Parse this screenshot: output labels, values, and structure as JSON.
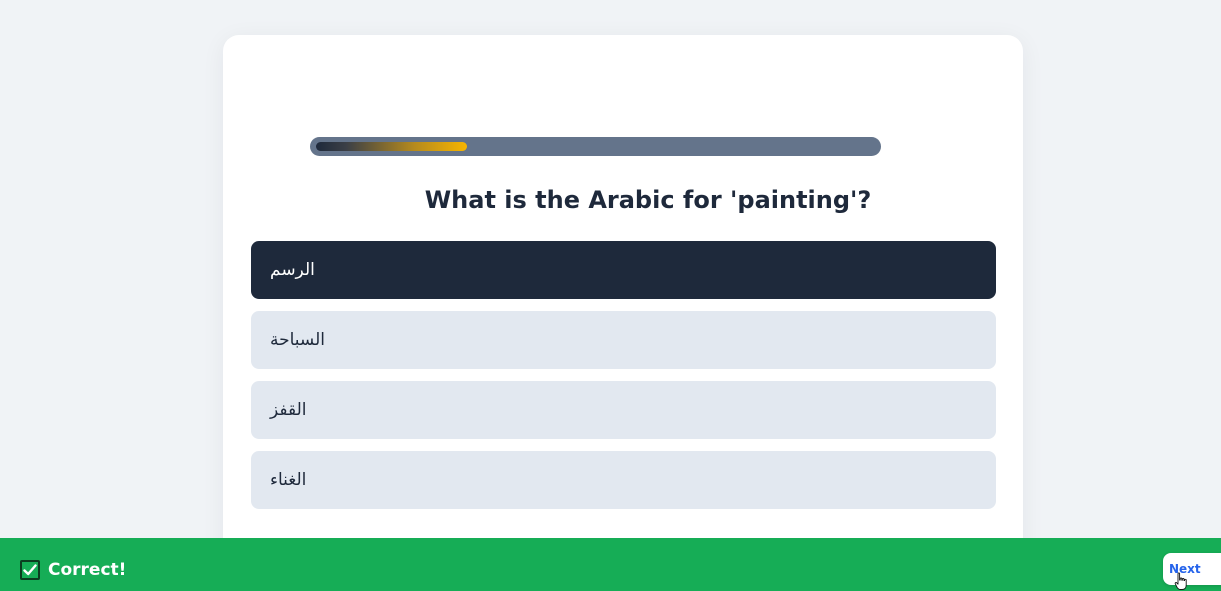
{
  "quiz": {
    "progress": 0.27,
    "question": "What is the Arabic for 'painting'?",
    "options": [
      {
        "label": "الرسم",
        "selected": true
      },
      {
        "label": "السباحة",
        "selected": false
      },
      {
        "label": "القفز",
        "selected": false
      },
      {
        "label": "الغناء",
        "selected": false
      }
    ]
  },
  "feedback": {
    "status_text": "Correct!",
    "next_label": "Next",
    "icon": "checkbox-check-icon",
    "bar_color": "#16ad56"
  },
  "colors": {
    "selected_option": "#1e293b",
    "option": "#e2e8f0",
    "accent_link": "#2563eb"
  }
}
